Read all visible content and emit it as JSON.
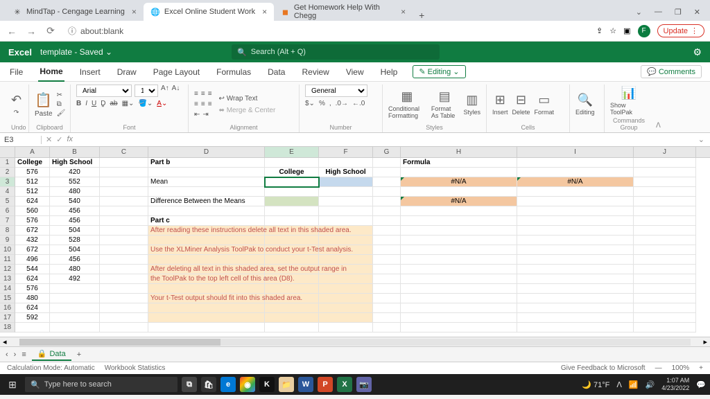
{
  "browser": {
    "tabs": [
      {
        "label": "MindTap - Cengage Learning"
      },
      {
        "label": "Excel Online Student Work"
      },
      {
        "label": "Get Homework Help With Chegg"
      }
    ],
    "url_host": "about:blank",
    "update": "Update",
    "avatar_letter": "F"
  },
  "excel": {
    "brand": "Excel",
    "doc": "template - Saved",
    "search_placeholder": "Search (Alt + Q)",
    "tabs": [
      "File",
      "Home",
      "Insert",
      "Draw",
      "Page Layout",
      "Formulas",
      "Data",
      "Review",
      "View",
      "Help"
    ],
    "mode": "Editing",
    "comments": "Comments"
  },
  "ribbon": {
    "undo": "Undo",
    "paste": "Paste",
    "clipboard": "Clipboard",
    "font_name": "Arial",
    "font_size": "10",
    "font": "Font",
    "wrap": "Wrap Text",
    "merge": "Merge & Center",
    "alignment": "Alignment",
    "number_format": "General",
    "number": "Number",
    "cond": "Conditional Formatting",
    "table": "Format As Table",
    "styles_btn": "Styles",
    "styles": "Styles",
    "insert": "Insert",
    "delete": "Delete",
    "format": "Format",
    "cells": "Cells",
    "editing": "Editing",
    "toolpak": "Show ToolPak",
    "commands": "Commands Group"
  },
  "namebox": "E3",
  "cols": [
    "A",
    "B",
    "C",
    "D",
    "E",
    "F",
    "G",
    "H",
    "I",
    "J"
  ],
  "data": {
    "r1": {
      "A": "College",
      "B": "High School",
      "D": "Part b",
      "H": "Formula"
    },
    "r2": {
      "A": "576",
      "B": "420",
      "E": "College",
      "F": "High School"
    },
    "r3": {
      "A": "512",
      "B": "552",
      "D": "Mean",
      "H": "#N/A",
      "I": "#N/A"
    },
    "r4": {
      "A": "512",
      "B": "480"
    },
    "r5": {
      "A": "624",
      "B": "540",
      "D": "Difference Between the Means",
      "H": "#N/A"
    },
    "r6": {
      "A": "560",
      "B": "456"
    },
    "r7": {
      "A": "576",
      "B": "456",
      "D": "Part c"
    },
    "r8": {
      "A": "672",
      "B": "504",
      "D": "After reading these instructions delete all text in this shaded area."
    },
    "r9": {
      "A": "432",
      "B": "528"
    },
    "r10": {
      "A": "672",
      "B": "504",
      "D": "Use the XLMiner Analysis ToolPak to conduct your t-Test analysis."
    },
    "r11": {
      "A": "496",
      "B": "456"
    },
    "r12": {
      "A": "544",
      "B": "480",
      "D": "After deleting all text in this shaded area, set the output range in"
    },
    "r13": {
      "A": "624",
      "B": "492",
      "D": "the ToolPak to the top left cell of this area (D8)."
    },
    "r14": {
      "A": "576"
    },
    "r15": {
      "A": "480",
      "D": "Your t-Test output should fit into this shaded area."
    },
    "r16": {
      "A": "624"
    },
    "r17": {
      "A": "592"
    }
  },
  "sheet": {
    "name": "Data"
  },
  "status": {
    "calc": "Calculation Mode: Automatic",
    "wb": "Workbook Statistics",
    "feedback": "Give Feedback to Microsoft",
    "zoom": "100%"
  },
  "taskbar": {
    "search": "Type here to search",
    "temp": "71°F",
    "time": "1:07 AM",
    "date": "4/23/2022"
  }
}
